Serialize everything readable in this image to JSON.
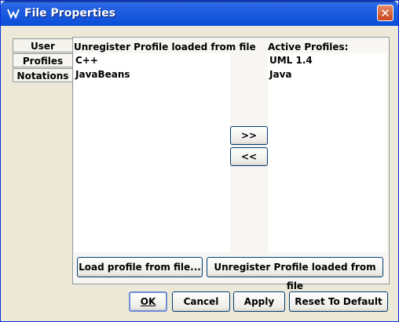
{
  "window": {
    "title": "File Properties",
    "close_label": "✕"
  },
  "tabs": [
    "User",
    "Profiles",
    "Notations"
  ],
  "available": {
    "header": "Unregister Profile loaded from file",
    "items": [
      "C++",
      "JavaBeans"
    ]
  },
  "active": {
    "header": "Active Profiles:",
    "items": [
      "UML 1.4",
      "Java"
    ]
  },
  "transfer": {
    "add_label": ">>",
    "remove_label": "<<"
  },
  "panel_buttons": {
    "load": "Load profile from file...",
    "unregister": "Unregister Profile loaded from file"
  },
  "footer": {
    "ok": "OK",
    "cancel": "Cancel",
    "apply": "Apply",
    "reset": "Reset To Default"
  }
}
